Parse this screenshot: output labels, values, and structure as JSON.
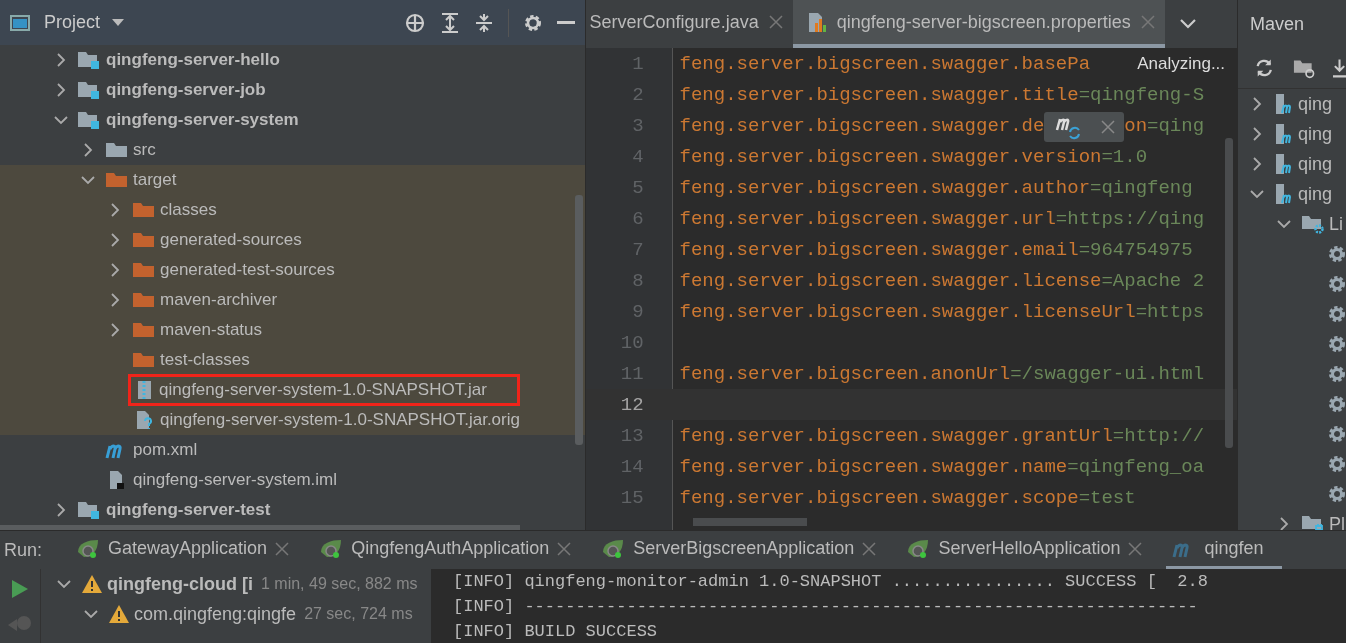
{
  "project": {
    "title": "Project",
    "tree": [
      {
        "name": "qingfeng-server-hello",
        "kind": "module",
        "expanded": false
      },
      {
        "name": "qingfeng-server-job",
        "kind": "module",
        "expanded": false
      },
      {
        "name": "qingfeng-server-system",
        "kind": "module",
        "expanded": true,
        "children": [
          {
            "name": "src",
            "kind": "folder",
            "expanded": false,
            "excluded": false
          },
          {
            "name": "target",
            "kind": "excluded-folder",
            "expanded": true,
            "excluded": true,
            "children": [
              {
                "name": "classes",
                "kind": "excluded-folder",
                "expanded": false,
                "marked": false
              },
              {
                "name": "generated-sources",
                "kind": "excluded-folder",
                "expanded": false,
                "marked": false
              },
              {
                "name": "generated-test-sources",
                "kind": "excluded-folder",
                "expanded": false,
                "marked": false
              },
              {
                "name": "maven-archiver",
                "kind": "excluded-folder",
                "expanded": false,
                "marked": false
              },
              {
                "name": "maven-status",
                "kind": "excluded-folder",
                "expanded": false,
                "marked": false
              },
              {
                "name": "test-classes",
                "kind": "excluded-folder",
                "marked": false
              },
              {
                "name": "qingfeng-server-system-1.0-SNAPSHOT.jar",
                "kind": "jar",
                "marked": true
              },
              {
                "name": "qingfeng-server-system-1.0-SNAPSHOT.jar.orig",
                "kind": "unknown-file",
                "marked": false
              }
            ]
          },
          {
            "name": "pom.xml",
            "kind": "maven-file",
            "excluded": false
          },
          {
            "name": "qingfeng-server-system.iml",
            "kind": "iml-file",
            "excluded": false
          }
        ]
      },
      {
        "name": "qingfeng-server-test",
        "kind": "module",
        "expanded": false
      }
    ]
  },
  "editor": {
    "tabs": [
      {
        "label": "ServerConfigure.java",
        "kind": "java",
        "selected": false
      },
      {
        "label": "qingfeng-server-bigscreen.properties",
        "kind": "properties",
        "selected": true
      }
    ],
    "status": "Analyzing...",
    "lines": [
      {
        "number": "1",
        "key": "feng.server.bigscreen.swagger.basePa",
        "current": false
      },
      {
        "number": "2",
        "key": "feng.server.bigscreen.swagger.title",
        "value": "=qingfeng-S",
        "current": false
      },
      {
        "number": "3",
        "key": "feng.server.bigscreen.swagger.de",
        "key_after_popup": "on",
        "value": "=qing",
        "current": false
      },
      {
        "number": "4",
        "key": "feng.server.bigscreen.swagger.version",
        "value": "=1.0",
        "current": false
      },
      {
        "number": "5",
        "key": "feng.server.bigscreen.swagger.author",
        "value": "=qingfeng",
        "current": false
      },
      {
        "number": "6",
        "key": "feng.server.bigscreen.swagger.url",
        "value": "=https://qing",
        "current": false
      },
      {
        "number": "7",
        "key": "feng.server.bigscreen.swagger.email",
        "value": "=964754975",
        "current": false
      },
      {
        "number": "8",
        "key": "feng.server.bigscreen.swagger.license",
        "value": "=Apache 2",
        "current": false
      },
      {
        "number": "9",
        "key": "feng.server.bigscreen.swagger.licenseUrl",
        "value": "=https",
        "current": false
      },
      {
        "number": "10",
        "current": false
      },
      {
        "number": "11",
        "key": "feng.server.bigscreen.anonUrl",
        "value": "=/swagger-ui.html",
        "current": false
      },
      {
        "number": "12",
        "current": true
      },
      {
        "number": "13",
        "key": "feng.server.bigscreen.swagger.grantUrl",
        "value": "=http://",
        "current": false
      },
      {
        "number": "14",
        "key": "feng.server.bigscreen.swagger.name",
        "value": "=qingfeng_oa",
        "current": false
      },
      {
        "number": "15",
        "key": "feng.server.bigscreen.swagger.scope",
        "value": "=test",
        "current": false
      }
    ]
  },
  "maven": {
    "title": "Maven",
    "tree": [
      {
        "label": "qing",
        "kind": "project",
        "expanded": false
      },
      {
        "label": "qing",
        "kind": "project",
        "expanded": false
      },
      {
        "label": "qing",
        "kind": "project",
        "expanded": false
      },
      {
        "label": "qing",
        "kind": "project",
        "expanded": true,
        "children": [
          {
            "label": "Li",
            "kind": "lifecycle",
            "expanded": true,
            "children": [
              {
                "kind": "goal"
              },
              {
                "kind": "goal"
              },
              {
                "kind": "goal"
              },
              {
                "kind": "goal"
              },
              {
                "kind": "goal"
              },
              {
                "kind": "goal"
              },
              {
                "kind": "goal"
              },
              {
                "kind": "goal"
              },
              {
                "kind": "goal"
              }
            ]
          },
          {
            "label": "Pl",
            "kind": "plugins",
            "expanded": false
          }
        ]
      }
    ]
  },
  "run": {
    "label": "Run:",
    "tabs": [
      {
        "label": "GatewayApplication",
        "kind": "spring",
        "selected": false
      },
      {
        "label": "QingfengAuthApplication",
        "kind": "spring",
        "selected": false
      },
      {
        "label": "ServerBigscreenApplication",
        "kind": "spring",
        "selected": false
      },
      {
        "label": "ServerHelloApplication",
        "kind": "spring",
        "selected": false
      },
      {
        "label": "qingfen",
        "kind": "maven",
        "selected": true
      }
    ],
    "tree": [
      {
        "label": "qingfeng-cloud [i",
        "time": "1 min, 49 sec, 882 ms",
        "warning": true,
        "expanded": true,
        "children": [
          {
            "label": "com.qingfeng:qingfe",
            "time": "27 sec, 724 ms",
            "warning": true,
            "expanded": true
          }
        ]
      }
    ],
    "console": [
      "[INFO] qingfeng-monitor-admin 1.0-SNAPSHOT ................ SUCCESS [  2.8",
      "[INFO] ------------------------------------------------------------------",
      "[INFO] BUILD SUCCESS"
    ]
  }
}
